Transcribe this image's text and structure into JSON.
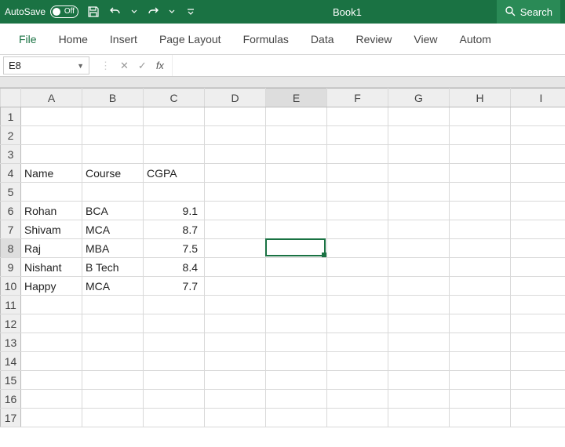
{
  "title_bar": {
    "autosave_label": "AutoSave",
    "autosave_state": "Off",
    "doc_title": "Book1",
    "search_label": "Search"
  },
  "ribbon": {
    "tabs": [
      "File",
      "Home",
      "Insert",
      "Page Layout",
      "Formulas",
      "Data",
      "Review",
      "View",
      "Autom"
    ]
  },
  "name_box": {
    "ref": "E8"
  },
  "fx": {
    "cancel": "✕",
    "confirm": "✓",
    "label": "fx"
  },
  "columns": [
    "A",
    "B",
    "C",
    "D",
    "E",
    "F",
    "G",
    "H",
    "I"
  ],
  "rows": 17,
  "selected": {
    "col": "E",
    "row": 8
  },
  "cells": {
    "A4": "Name",
    "B4": "Course",
    "C4": "CGPA",
    "A6": "Rohan",
    "B6": "BCA",
    "C6": "9.1",
    "A7": "Shivam",
    "B7": "MCA",
    "C7": "8.7",
    "A8": "Raj",
    "B8": "MBA",
    "C8": "7.5",
    "A9": "Nishant",
    "B9": "B Tech",
    "C9": "8.4",
    "A10": "Happy",
    "B10": "MCA",
    "C10": "7.7"
  },
  "chart_data": {
    "type": "table",
    "title": "",
    "columns": [
      "Name",
      "Course",
      "CGPA"
    ],
    "rows": [
      {
        "Name": "Rohan",
        "Course": "BCA",
        "CGPA": 9.1
      },
      {
        "Name": "Shivam",
        "Course": "MCA",
        "CGPA": 8.7
      },
      {
        "Name": "Raj",
        "Course": "MBA",
        "CGPA": 7.5
      },
      {
        "Name": "Nishant",
        "Course": "B Tech",
        "CGPA": 8.4
      },
      {
        "Name": "Happy",
        "Course": "MCA",
        "CGPA": 7.7
      }
    ]
  }
}
